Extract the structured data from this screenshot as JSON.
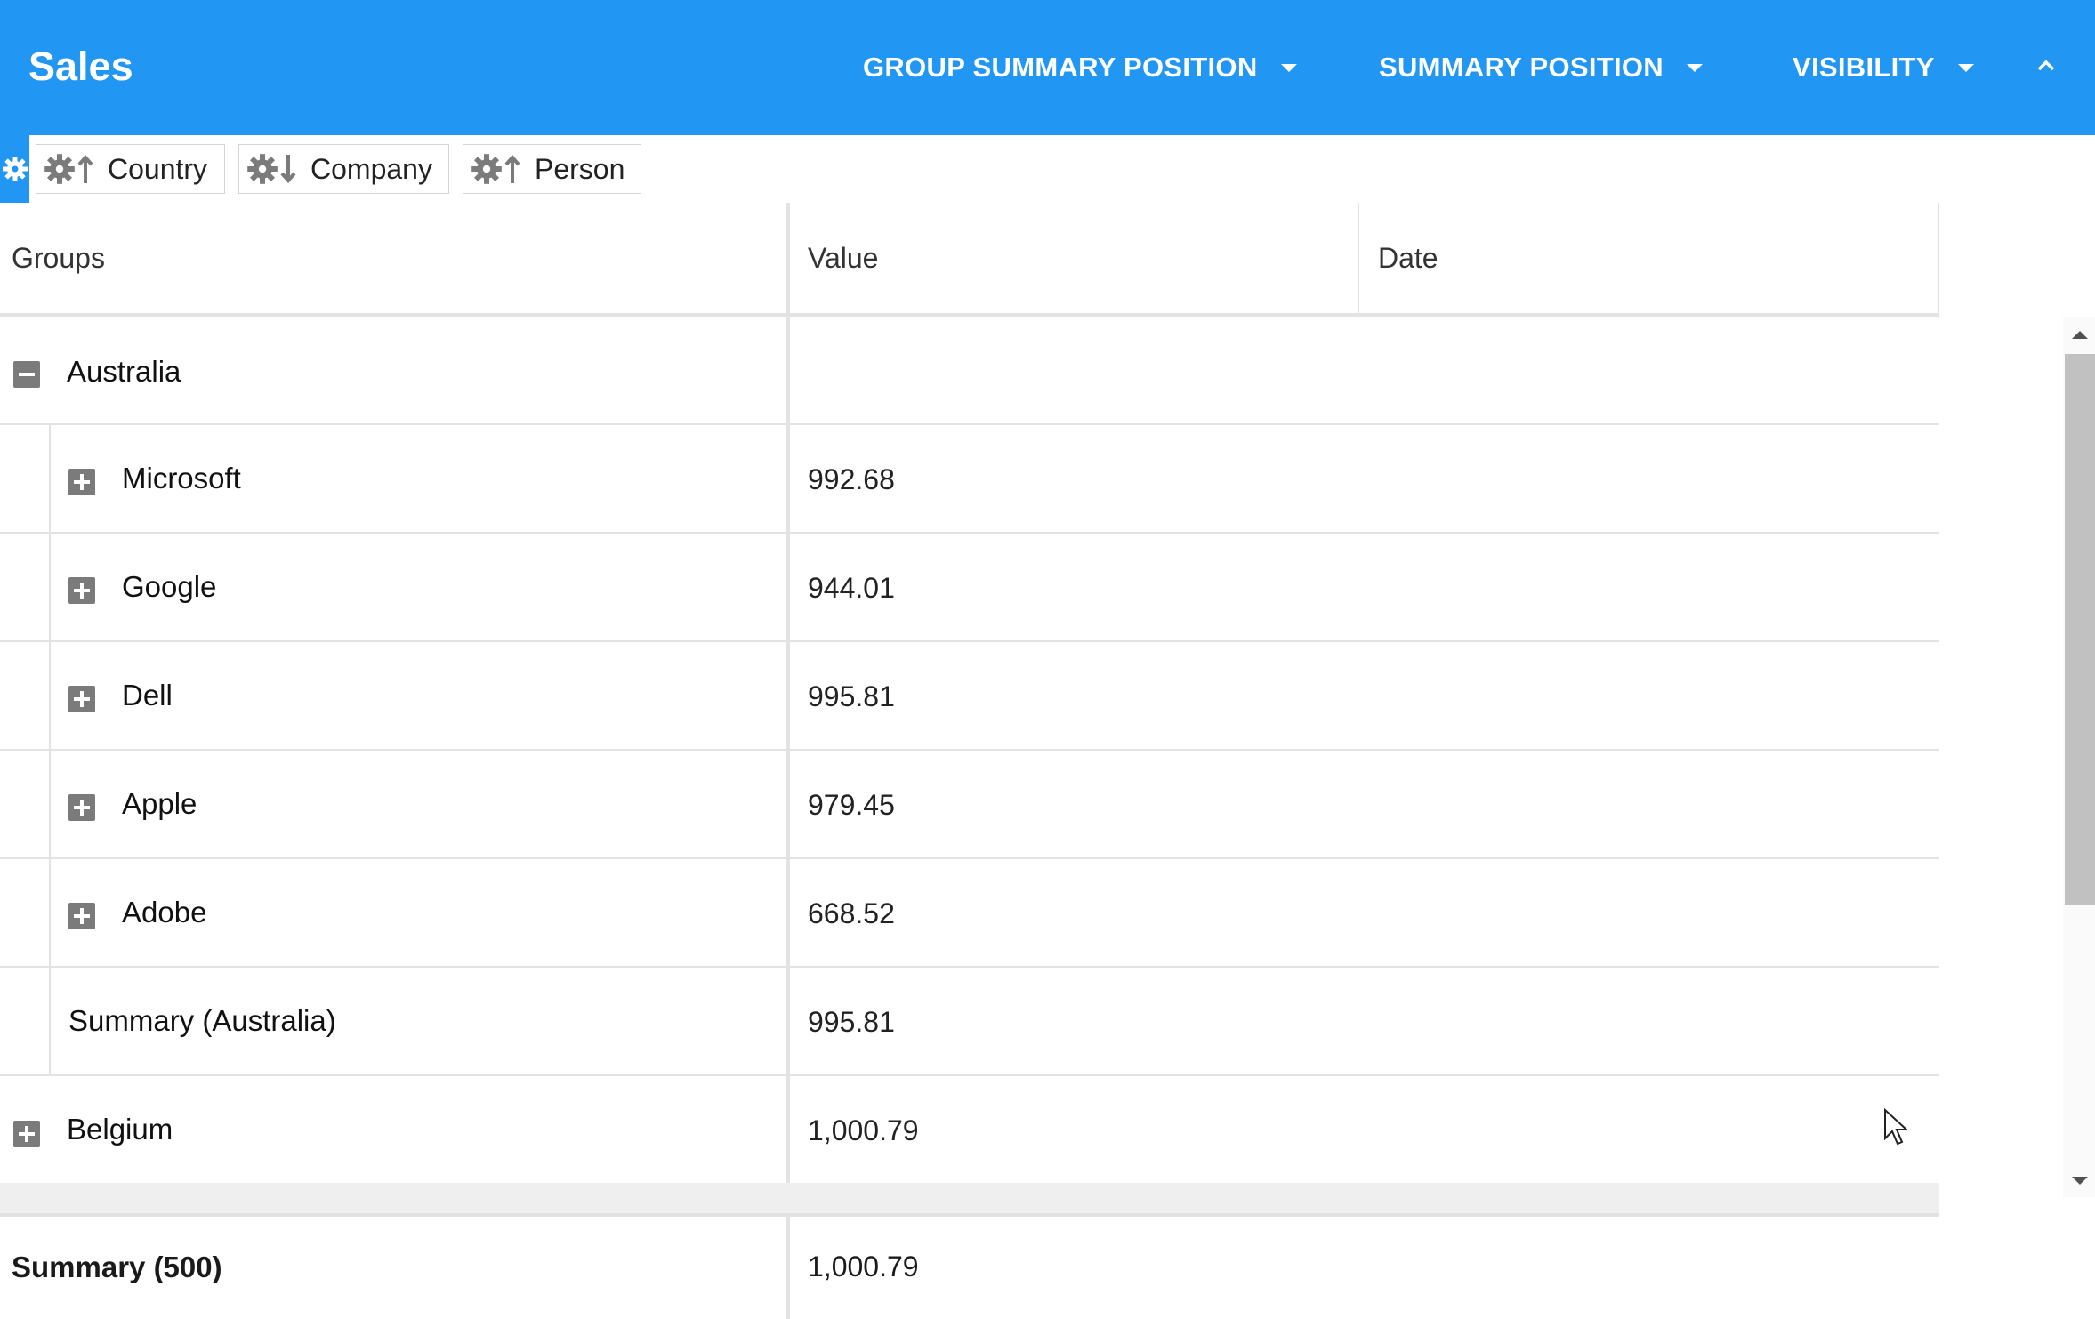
{
  "header": {
    "title": "Sales",
    "buttons": [
      {
        "label": "GROUP SUMMARY POSITION"
      },
      {
        "label": "SUMMARY POSITION"
      },
      {
        "label": "VISIBILITY"
      }
    ]
  },
  "group_panel": {
    "chips": [
      {
        "label": "Country",
        "sort": "ascending"
      },
      {
        "label": "Company",
        "sort": "descending"
      },
      {
        "label": "Person",
        "sort": "ascending"
      }
    ]
  },
  "grid": {
    "columns": [
      "Groups",
      "Value",
      "Date"
    ],
    "rows": [
      {
        "label": "Australia",
        "value": "",
        "state": "expanded",
        "level": 0
      },
      {
        "label": "Microsoft",
        "value": "992.68",
        "state": "collapsed",
        "level": 1
      },
      {
        "label": "Google",
        "value": "944.01",
        "state": "collapsed",
        "level": 1
      },
      {
        "label": "Dell",
        "value": "995.81",
        "state": "collapsed",
        "level": 1
      },
      {
        "label": "Apple",
        "value": "979.45",
        "state": "collapsed",
        "level": 1
      },
      {
        "label": "Adobe",
        "value": "668.52",
        "state": "collapsed",
        "level": 1
      },
      {
        "label": "Summary (Australia)",
        "value": "995.81",
        "state": "summary",
        "level": 1
      },
      {
        "label": "Belgium",
        "value": "1,000.79",
        "state": "collapsed",
        "level": 0
      }
    ],
    "footer": {
      "label": "Summary (500)",
      "value": "1,000.79"
    }
  },
  "icons": {
    "settings": "gear-icon",
    "sort_asc": "arrow-up-icon",
    "sort_desc": "arrow-down-icon",
    "expand": "plus-icon",
    "collapse": "minus-icon",
    "caret": "caret-down-icon",
    "collapse_header": "chevron-up-icon"
  },
  "colors": {
    "accent": "#2196f3",
    "toggle": "#7b7b7b",
    "grid_line": "#e3e3e3"
  }
}
